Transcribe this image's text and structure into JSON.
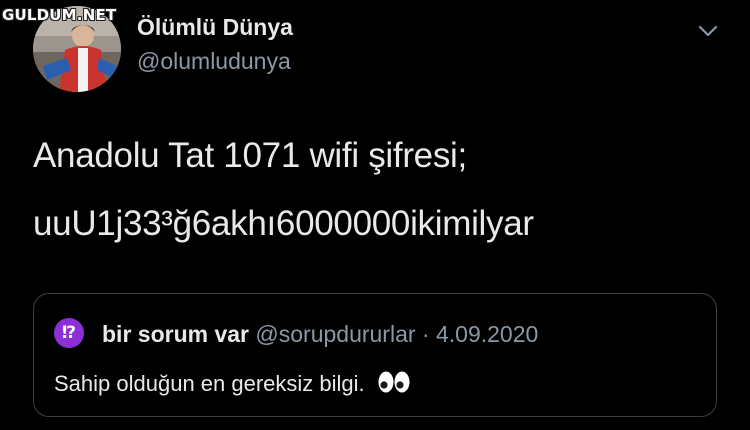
{
  "watermark": "GULDUM.NET",
  "tweet": {
    "display_name": "Ölümlü Dünya",
    "handle": "@olumludunya",
    "text_line1": "Anadolu Tat 1071 wifi şifresi;",
    "text_line2": "uuU1j33³ğ6akhı6000000ikimilyar"
  },
  "quoted_tweet": {
    "avatar_glyph": "⁉",
    "avatar_color": "#8b2fd6",
    "display_name": "bir sorum var",
    "handle": "@sorupdururlar",
    "separator": "·",
    "date": "4.09.2020",
    "text": "Sahip olduğun en gereksiz bilgi.",
    "emoji_icon": "eyes-icon"
  },
  "colors": {
    "background": "#000000",
    "text_primary": "#e7e9ea",
    "text_secondary": "#8b98a5",
    "border": "#3a3f44"
  }
}
